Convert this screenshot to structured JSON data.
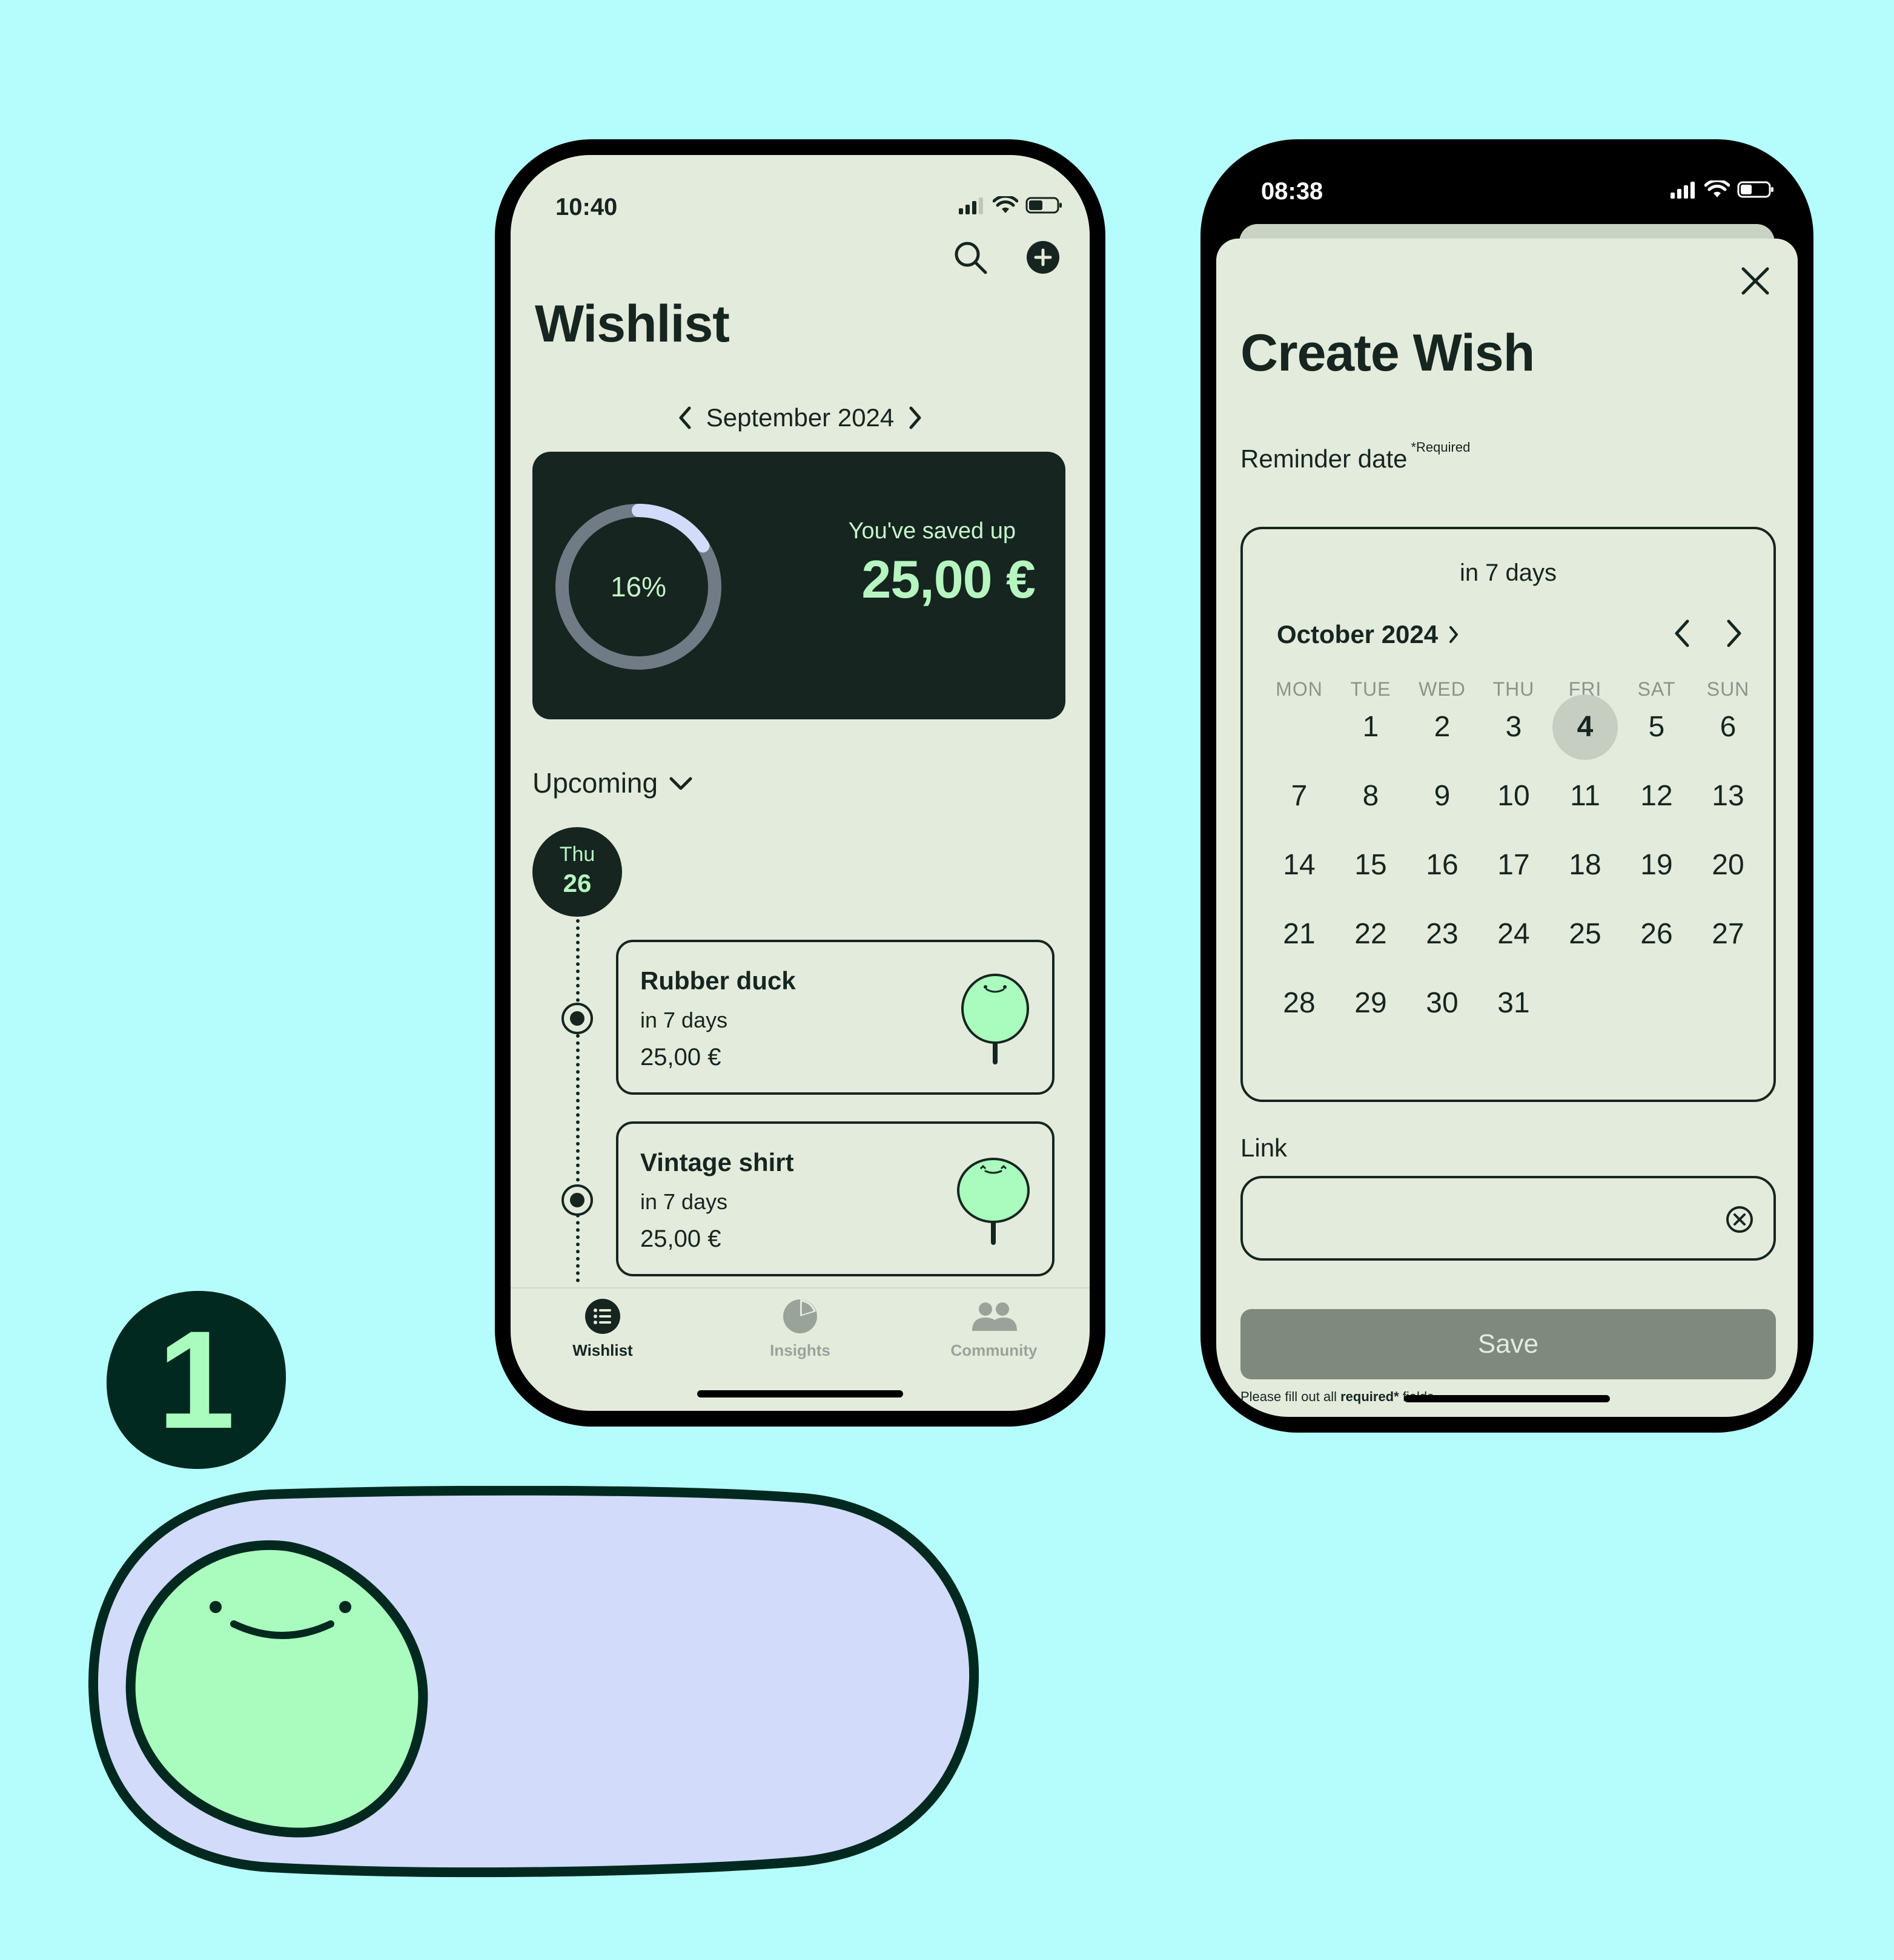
{
  "colors": {
    "background": "#b5fdfd",
    "screen": "#e3ebdd",
    "dark": "#16251f",
    "accent_mint": "#a9fcbe",
    "accent_lavender": "#d2dbfa",
    "button_disabled": "#7e8a7d"
  },
  "wishlist_screen": {
    "status_time": "10:40",
    "status_icons": [
      "signal-icon",
      "wifi-icon",
      "battery-icon"
    ],
    "header_icons": [
      "search-icon",
      "add-icon"
    ],
    "title": "Wishlist",
    "month": "September 2024",
    "progress_percent": 16,
    "progress_label": "16%",
    "saved_label": "You've saved up",
    "saved_amount": "25,00 €",
    "filter_label": "Upcoming",
    "day_name": "Thu",
    "day_number": "26",
    "wishes": [
      {
        "name": "Rubber duck",
        "when": "in 7 days",
        "price": "25,00 €"
      },
      {
        "name": "Vintage shirt",
        "when": "in 7 days",
        "price": "25,00 €"
      }
    ],
    "tabs": [
      {
        "label": "Wishlist",
        "icon": "list-icon",
        "active": true
      },
      {
        "label": "Insights",
        "icon": "pie-chart-icon",
        "active": false
      },
      {
        "label": "Community",
        "icon": "people-icon",
        "active": false
      }
    ]
  },
  "create_screen": {
    "status_time": "08:38",
    "title": "Create Wish",
    "reminder_label": "Reminder date",
    "required_tag": "*Required",
    "in_days": "in 7 days",
    "calendar_month": "October 2024",
    "weekdays": [
      "MON",
      "TUE",
      "WED",
      "THU",
      "FRI",
      "SAT",
      "SUN"
    ],
    "first_weekday_index": 1,
    "days_in_month": 31,
    "selected_day": 4,
    "link_label": "Link",
    "link_value": "",
    "save_label": "Save",
    "required_note_prefix": "Please fill out all ",
    "required_note_bold": "required*",
    "required_note_suffix": " fields"
  },
  "decor": {
    "step_number": "1"
  }
}
